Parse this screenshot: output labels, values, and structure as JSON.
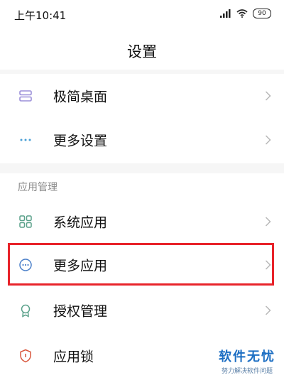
{
  "status_bar": {
    "time": "上午10:41",
    "battery": "90",
    "icons": [
      "signal-icon",
      "wifi-icon",
      "battery-icon"
    ]
  },
  "header": {
    "title": "设置"
  },
  "rows_top": [
    {
      "label": "极简桌面",
      "icon": "minimal-desktop-icon"
    },
    {
      "label": "更多设置",
      "icon": "more-dots-icon"
    }
  ],
  "app_section": {
    "header": "应用管理",
    "items": [
      {
        "label": "系统应用",
        "icon": "grid-apps-icon"
      },
      {
        "label": "更多应用",
        "icon": "more-circle-icon",
        "highlighted": true
      },
      {
        "label": "授权管理",
        "icon": "badge-icon"
      },
      {
        "label": "应用锁",
        "icon": "shield-lock-icon"
      }
    ]
  },
  "watermark": {
    "main": "软件无忧",
    "sub": "努力解决软件问题"
  },
  "colors": {
    "accent_icon": "#5aa18a",
    "highlight_border": "#e8232a",
    "watermark": "#1c6ec3"
  }
}
